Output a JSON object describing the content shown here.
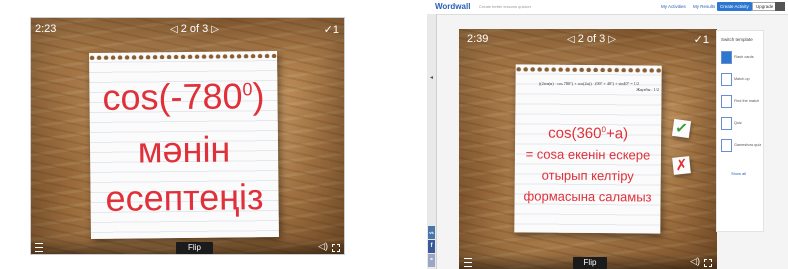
{
  "left_card": {
    "timer": "2:23",
    "pager": {
      "prev": "◁",
      "text": "2 of 3",
      "next": "▷"
    },
    "check": "✓1",
    "lines": [
      "cos(-780",
      "0",
      ")",
      "мəнін",
      "есептеңіз"
    ],
    "flip_label": "Flip"
  },
  "right_window": {
    "header": {
      "logo": "Wordwall",
      "tagline": "Create better lessons quicker",
      "links": [
        "My Activities",
        "My Results"
      ],
      "create_button": "Create Activity",
      "upgrade_button": "Upgrade",
      "user_initial": "В"
    },
    "share": {
      "vk": "vk",
      "facebook": "f"
    },
    "card": {
      "timer": "2:39",
      "pager": {
        "prev": "◁",
        "text": "2 of 3",
        "next": "▷"
      },
      "check": "✓1",
      "formula_lines": [
        "((2sin(α) · cos 780°) + cos(2α)) · (90° + 40°) + sin40° = 1/2",
        "Жауабы : 1/2"
      ],
      "lines": [
        "cos(360",
        "0",
        "+a)",
        "= cosa екенін ескере",
        "отырып келтіру",
        "формасына саламыз"
      ],
      "flip_label": "Flip",
      "marks": {
        "correct": "✓",
        "wrong": "✗"
      }
    },
    "template_panel": {
      "title": "Switch template",
      "items": [
        "Flash cards",
        "Match up",
        "Find the match",
        "Quiz",
        "Gameshow quiz"
      ],
      "show_all": "Show all"
    }
  },
  "colors": {
    "card_text": "#e0303a",
    "wood": "#a77745",
    "accent": "#2e77d0",
    "correct": "#2f9e2f",
    "wrong": "#e0303a"
  }
}
